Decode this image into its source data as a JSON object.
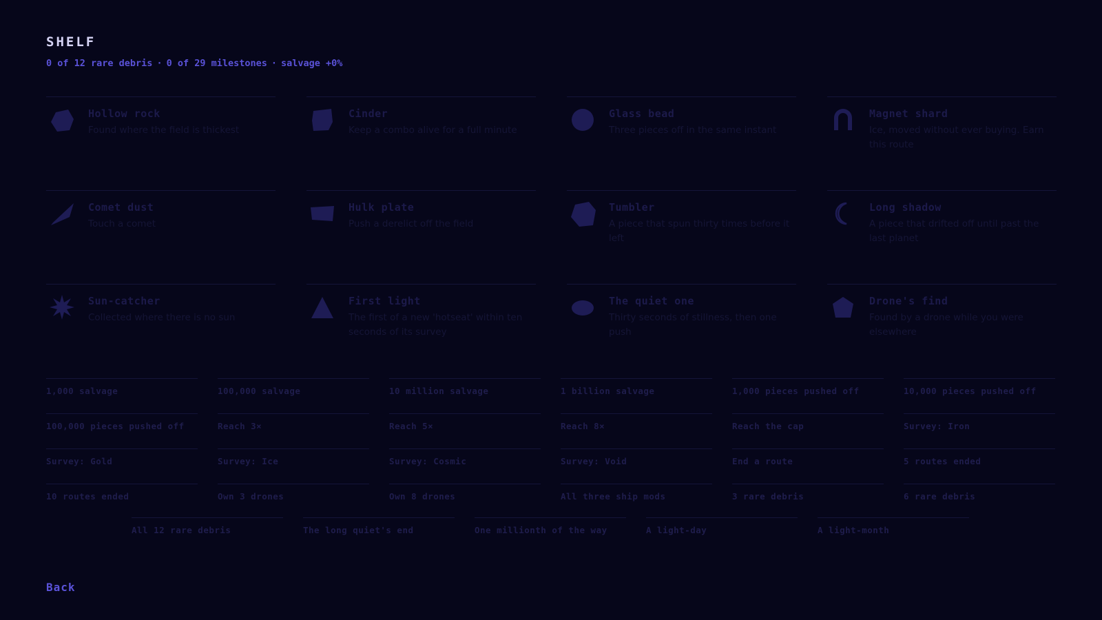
{
  "screen": {
    "title": "SHELF",
    "stats": {
      "rare": "0 of 12 rare debris",
      "milestones": "0 of 29 milestones",
      "salvage": "salvage +0%",
      "separator": "·"
    },
    "back_label": "Back"
  },
  "colors": {
    "background": "#06061a",
    "accent": "#5a52d8",
    "locked_text": "#1c1a4a",
    "locked_shape": "#1e1c55"
  },
  "rare_debris": [
    {
      "name": "Hollow rock",
      "desc": "Found where the field is thickest",
      "icon": "hollow-rock-icon"
    },
    {
      "name": "Cinder",
      "desc": "Keep a combo alive for a full minute",
      "icon": "cinder-icon"
    },
    {
      "name": "Glass bead",
      "desc": "Three pieces off in the same instant",
      "icon": "glass-bead-icon"
    },
    {
      "name": "Magnet shard",
      "desc": "Ice, moved without ever buying. Earn this route",
      "icon": "magnet-shard-icon"
    },
    {
      "name": "Comet dust",
      "desc": "Touch a comet",
      "icon": "comet-dust-icon"
    },
    {
      "name": "Hulk plate",
      "desc": "Push a derelict off the field",
      "icon": "hulk-plate-icon"
    },
    {
      "name": "Tumbler",
      "desc": "A piece that spun thirty times before it left",
      "icon": "tumbler-icon"
    },
    {
      "name": "Long shadow",
      "desc": "A piece that drifted off until past the last planet",
      "icon": "long-shadow-icon"
    },
    {
      "name": "Sun-catcher",
      "desc": "Collected where there is no sun",
      "icon": "sun-catcher-icon"
    },
    {
      "name": "First light",
      "desc": "The first of a new 'hotseat' within ten seconds of its survey",
      "icon": "first-light-icon"
    },
    {
      "name": "The quiet one",
      "desc": "Thirty seconds of stillness, then one push",
      "icon": "quiet-one-icon"
    },
    {
      "name": "Drone's find",
      "desc": "Found by a drone while you were elsewhere",
      "icon": "drones-find-icon"
    }
  ],
  "milestones": [
    "1,000 salvage",
    "100,000 salvage",
    "10 million salvage",
    "1 billion salvage",
    "1,000 pieces pushed off",
    "10,000 pieces pushed off",
    "100,000 pieces pushed off",
    "Reach 3×",
    "Reach 5×",
    "Reach 8×",
    "Reach the cap",
    "Survey: Iron",
    "Survey: Gold",
    "Survey: Ice",
    "Survey: Cosmic",
    "Survey: Void",
    "End a route",
    "5 routes ended",
    "10 routes ended",
    "Own 3 drones",
    "Own 8 drones",
    "All three ship mods",
    "3 rare debris",
    "6 rare debris"
  ],
  "milestones_final": [
    "All 12 rare debris",
    "The long quiet's end",
    "One millionth of the way",
    "A light-day",
    "A light-month"
  ]
}
